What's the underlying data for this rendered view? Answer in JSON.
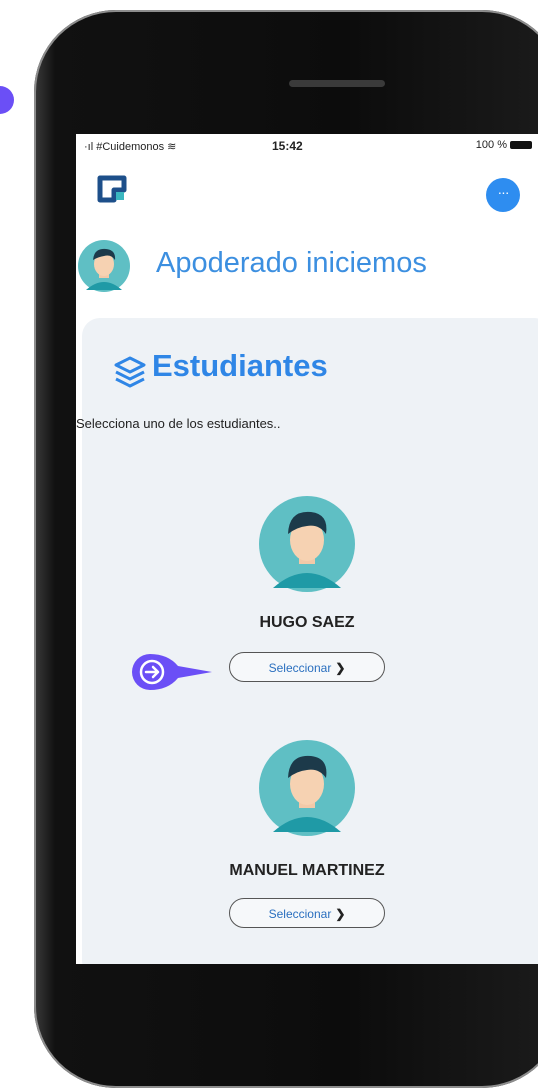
{
  "status_bar": {
    "carrier": "#Cuidemonos",
    "time": "15:42",
    "battery": "100 %"
  },
  "header": {
    "menu_label": "···",
    "greeting": "Apoderado iniciemos"
  },
  "students_card": {
    "title": "Estudiantes",
    "instruction": "Selecciona uno de los estudiantes..",
    "students": [
      {
        "name": "HUGO SAEZ",
        "button_label": "Seleccionar"
      },
      {
        "name": "MANUEL MARTINEZ",
        "button_label": "Seleccionar"
      }
    ]
  },
  "colors": {
    "accent": "#2f86e6",
    "pointer": "#6b4ff6",
    "card_bg": "#eef2f6",
    "avatar_bg": "#5fbfc4"
  }
}
